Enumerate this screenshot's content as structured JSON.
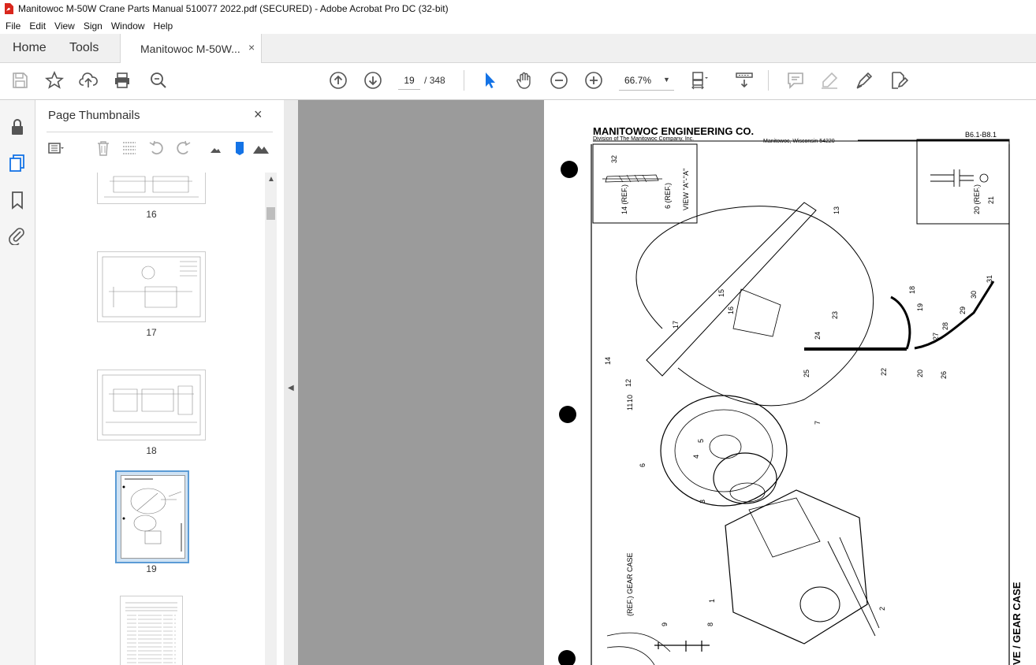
{
  "window": {
    "title": "Manitowoc M-50W Crane Parts Manual 510077 2022.pdf (SECURED) - Adobe Acrobat Pro DC (32-bit)"
  },
  "menu": [
    "File",
    "Edit",
    "View",
    "Sign",
    "Window",
    "Help"
  ],
  "tabs": {
    "home": "Home",
    "tools": "Tools",
    "document": "Manitowoc M-50W...",
    "close": "×"
  },
  "toolbar": {
    "current_page": "19",
    "page_separator": "/",
    "total_pages": "348",
    "zoom": "66.7%"
  },
  "thumbnails_panel": {
    "title": "Page Thumbnails",
    "close": "×",
    "pages": [
      "16",
      "17",
      "18",
      "19"
    ],
    "selected_page": "19"
  },
  "document_page": {
    "company": "MANITOWOC ENGINEERING CO.",
    "division": "Division of The Manitowoc Company, Inc.",
    "location": "Manitowoc, Wisconsin 54220",
    "ref_code": "B6.1-B8.1",
    "view_label": "VIEW \"A\"-\"A\"",
    "gear_case_ref": "(REF.) GEAR CASE",
    "side_title": "VE / GEAR CASE",
    "callouts": [
      "32",
      "14 (REF.)",
      "6 (REF.)",
      "20 (REF.)",
      "21",
      "13",
      "15",
      "16",
      "17",
      "18",
      "19",
      "20",
      "22",
      "23",
      "24",
      "25",
      "26",
      "27",
      "28",
      "29",
      "30",
      "31",
      "14",
      "12",
      "10",
      "11",
      "7",
      "5",
      "4",
      "6",
      "3",
      "1",
      "2",
      "9",
      "8"
    ]
  },
  "colors": {
    "accent": "#1473e6",
    "viewer_bg": "#9b9b9b",
    "selection": "#5b9bd5"
  }
}
